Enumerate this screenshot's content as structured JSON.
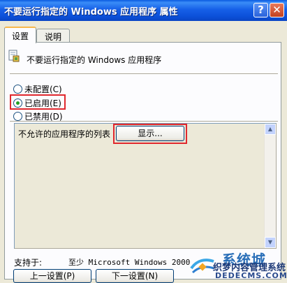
{
  "window": {
    "title": "不要运行指定的 Windows 应用程序 属性",
    "help_glyph": "?",
    "close_glyph": "✕"
  },
  "tabs": [
    {
      "label": "设置",
      "active": true
    },
    {
      "label": "说明",
      "active": false
    }
  ],
  "policy": {
    "title": "不要运行指定的 Windows 应用程序",
    "icon": "policy-setting-icon"
  },
  "radios": [
    {
      "label": "未配置(C)",
      "checked": false
    },
    {
      "label": "已启用(E)",
      "checked": true
    },
    {
      "label": "已禁用(D)",
      "checked": false
    }
  ],
  "options": {
    "label": "不允许的应用程序的列表",
    "show_button": "显示..."
  },
  "support": {
    "label": "支持于:",
    "value": "至少 Microsoft Windows 2000"
  },
  "buttons": {
    "prev": "上一设置(P)",
    "next": "下一设置(N)"
  },
  "watermark": {
    "brand": "系统城",
    "subtitle": "织梦内容管理系统",
    "domain": "DEDECMS.COM"
  },
  "colors": {
    "highlight": "#e0282e",
    "titlebar": "#0b4fd8",
    "dialog": "#ece9d8"
  }
}
